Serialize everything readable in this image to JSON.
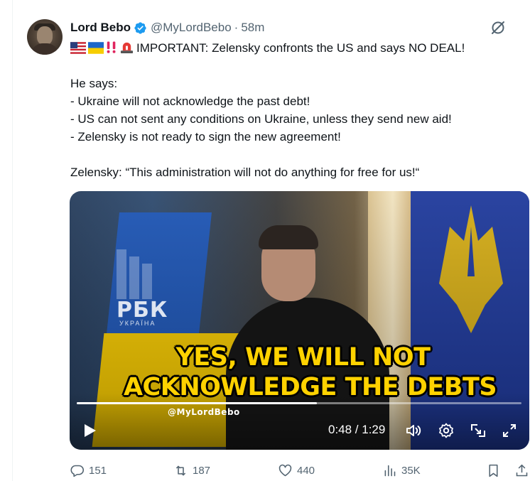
{
  "tweet": {
    "author": {
      "display_name": "Lord Bebo",
      "handle": "@MyLordBebo",
      "separator": "·",
      "time": "58m",
      "verified": true
    },
    "text": {
      "line_1": "IMPORTANT: Zelensky confronts the US and says NO DEAL!",
      "line_1_emojis": [
        "us-flag",
        "ukraine-flag",
        "double-exclamation",
        "rotating-light"
      ],
      "line_2": "He says:",
      "line_3": "- Ukraine will not acknowledge the past debt!",
      "line_4": "- US can not sent any conditions on Ukraine, unless they send new aid!",
      "line_5": "- Zelensky is not ready to sign the new agreement!",
      "line_6": "Zelensky: “This administration will not do anything for free for us!“"
    },
    "video": {
      "caption_line_1": "YES, WE WILL NOT",
      "caption_line_2": "ACKNOWLEDGE THE DEBTS",
      "watermark": "@MyLordBebo",
      "channel_logo": "РБК",
      "channel_sub": "УКРАЇНА",
      "time_readout": "0:48 / 1:29",
      "progress": 0.54
    },
    "actions": {
      "replies": "151",
      "reposts": "187",
      "likes": "440",
      "views": "35K"
    }
  },
  "icons": {
    "verified": "verified-badge-icon",
    "grok": "grok-icon",
    "reply": "reply-icon",
    "repost": "repost-icon",
    "like": "heart-icon",
    "views": "views-icon",
    "bookmark": "bookmark-icon",
    "share": "share-icon",
    "play": "play-icon",
    "volume": "volume-icon",
    "settings": "settings-icon",
    "pip": "picture-in-picture-icon",
    "fullscreen": "fullscreen-icon"
  },
  "colors": {
    "verified_blue": "#1d9bf0",
    "text_primary": "#0f1419",
    "text_secondary": "#536471",
    "caption_yellow": "#ffd200"
  }
}
